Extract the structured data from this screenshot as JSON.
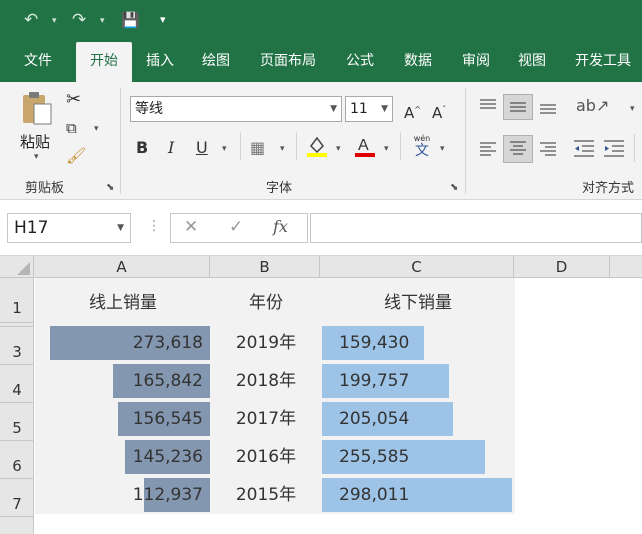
{
  "quick_access": {
    "undo": "↶",
    "redo": "↷",
    "save": "💾",
    "more": "▾"
  },
  "tabs": [
    {
      "label": "文件",
      "active": false
    },
    {
      "label": "开始",
      "active": true
    },
    {
      "label": "插入",
      "active": false
    },
    {
      "label": "绘图",
      "active": false
    },
    {
      "label": "页面布局",
      "active": false
    },
    {
      "label": "公式",
      "active": false
    },
    {
      "label": "数据",
      "active": false
    },
    {
      "label": "审阅",
      "active": false
    },
    {
      "label": "视图",
      "active": false
    },
    {
      "label": "开发工具",
      "active": false
    }
  ],
  "ribbon": {
    "clipboard": {
      "paste_label": "粘贴",
      "group_label": "剪贴板"
    },
    "font": {
      "font_name": "等线",
      "font_size": "11",
      "group_label": "字体",
      "bold": "B",
      "italic": "I",
      "underline": "U",
      "wen": "wén",
      "wen_char": "文"
    },
    "align": {
      "group_label": "对齐方式"
    }
  },
  "formula_bar": {
    "name_box": "H17",
    "cancel": "✕",
    "enter": "✓",
    "fx": "fx",
    "formula": ""
  },
  "columns": [
    "A",
    "B",
    "C",
    "D"
  ],
  "rows": [
    "1",
    "3",
    "4",
    "5",
    "6",
    "7"
  ],
  "table": {
    "header_left": "线上销量",
    "header_mid": "年份",
    "header_right": "线下销量",
    "rows": [
      {
        "online": "273,618",
        "online_value": 273618,
        "year": "2019年",
        "offline": "159,430",
        "offline_value": 159430
      },
      {
        "online": "165,842",
        "online_value": 165842,
        "year": "2018年",
        "offline": "199,757",
        "offline_value": 199757
      },
      {
        "online": "156,545",
        "online_value": 156545,
        "year": "2017年",
        "offline": "205,054",
        "offline_value": 205054
      },
      {
        "online": "145,236",
        "online_value": 145236,
        "year": "2016年",
        "offline": "255,585",
        "offline_value": 255585
      },
      {
        "online": "112,937",
        "online_value": 112937,
        "year": "2015年",
        "offline": "298,011",
        "offline_value": 298011
      }
    ]
  },
  "colors": {
    "ribbon_green": "#217346",
    "online_bar": "#8497b0",
    "offline_bar": "#9dc3e6",
    "table_bg": "#f2f2f2"
  }
}
